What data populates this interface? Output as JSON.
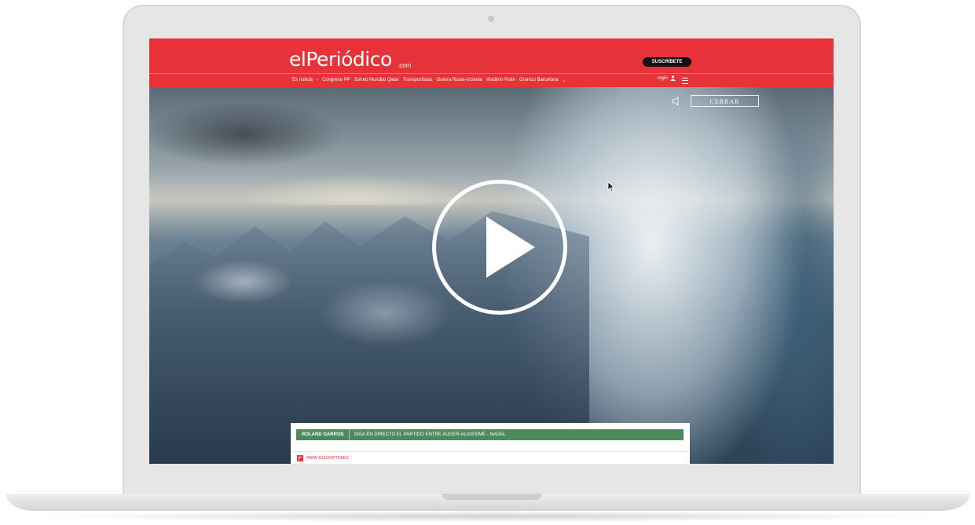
{
  "site": {
    "logo": "elPeriódico",
    "logo_suffix": ".com",
    "subscribe_label": "SUSCRÍBETE",
    "login_label": "login",
    "brand_color": "#e8323a"
  },
  "nav": {
    "items": [
      "Es noticia",
      "›",
      "Congreso PP",
      "Sorteo Mundial Qatar",
      "Transportistas",
      "Guerra Rusia-Ucrania",
      "Vladimir Putin",
      "Granizo Barcelona",
      "⌄"
    ]
  },
  "video": {
    "close_label": "CERRAR",
    "play_icon": "play-icon",
    "mute_icon": "speaker-muted-icon"
  },
  "panel": {
    "breaking_tag": "ROLAND GARROS",
    "breaking_text": "SIGA EN DIRECTO EL PARTIDO ENTRE AUGER-ALIASSIME - NADAL",
    "breaking_color": "#4b8a5c",
    "subscribers_label": "PARA SUSCRIPTORES"
  }
}
